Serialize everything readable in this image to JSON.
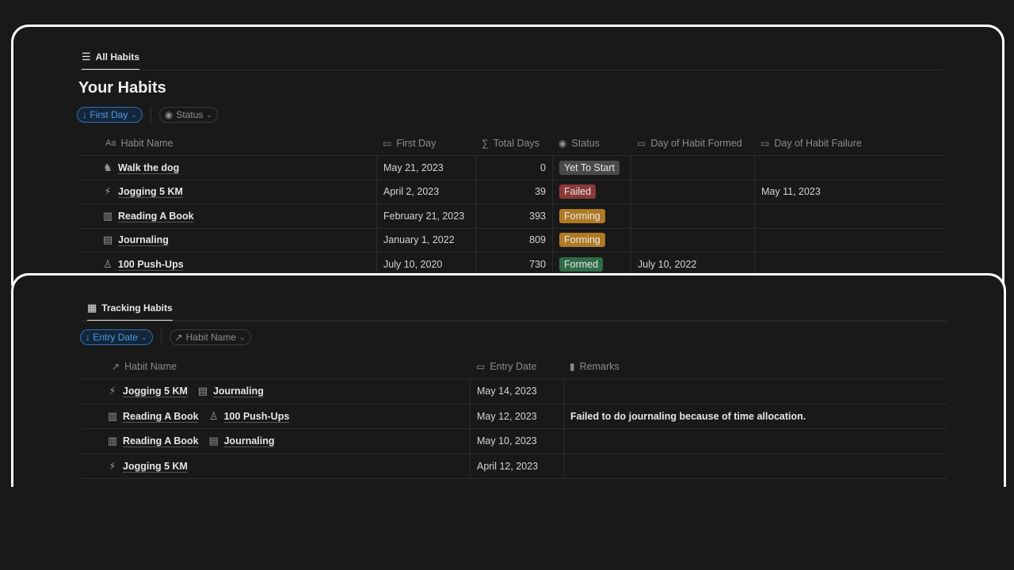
{
  "colors": {
    "background": "#191919",
    "frame": "#ffffff",
    "accent_blue": "#4d9be6",
    "status_yet_to_start": "#4a4a4a",
    "status_failed": "#8a3a37",
    "status_forming": "#b07a25",
    "status_formed": "#2f6b46"
  },
  "habits_view": {
    "tab_label": "All Habits",
    "tab_icon": "list-icon",
    "title": "Your Habits",
    "filters": [
      {
        "label": "↓ First Day",
        "icon": "chevron-down-icon",
        "active": true
      },
      {
        "label": "Status",
        "icon": "status-icon",
        "active": false
      }
    ],
    "columns": [
      {
        "label": "Habit Name",
        "icon": "Aa"
      },
      {
        "label": "First Day",
        "icon": "calendar-icon"
      },
      {
        "label": "Total Days",
        "icon": "formula-icon"
      },
      {
        "label": "Status",
        "icon": "status-icon"
      },
      {
        "label": "Day of Habit Formed",
        "icon": "calendar-icon"
      },
      {
        "label": "Day of Habit Failure",
        "icon": "calendar-icon"
      }
    ],
    "rows": [
      {
        "icon": "dog-icon",
        "name": "Walk the dog",
        "first_day": "May 21, 2023",
        "total_days": "0",
        "status": "Yet To Start",
        "status_color": "#4a4a4a",
        "formed": "",
        "failure": ""
      },
      {
        "icon": "runner-icon",
        "name": "Jogging 5 KM",
        "first_day": "April 2, 2023",
        "total_days": "39",
        "status": "Failed",
        "status_color": "#8a3a37",
        "formed": "",
        "failure": "May 11, 2023"
      },
      {
        "icon": "book-icon",
        "name": "Reading A Book",
        "first_day": "February 21, 2023",
        "total_days": "393",
        "status": "Forming",
        "status_color": "#b07a25",
        "formed": "",
        "failure": ""
      },
      {
        "icon": "notebook-icon",
        "name": "Journaling",
        "first_day": "January 1, 2022",
        "total_days": "809",
        "status": "Forming",
        "status_color": "#b07a25",
        "formed": "",
        "failure": ""
      },
      {
        "icon": "person-icon",
        "name": "100 Push-Ups",
        "first_day": "July 10, 2020",
        "total_days": "730",
        "status": "Formed",
        "status_color": "#2f6b46",
        "formed": "July 10, 2022",
        "failure": ""
      }
    ]
  },
  "tracking_view": {
    "tab_label": "Tracking Habits",
    "tab_icon": "table-icon",
    "filters": [
      {
        "label": "↓ Entry Date",
        "active": true
      },
      {
        "label": "Habit Name",
        "active": false
      }
    ],
    "columns": [
      {
        "label": "Habit Name",
        "icon": "relation-arrow-icon"
      },
      {
        "label": "Entry Date",
        "icon": "calendar-icon"
      },
      {
        "label": "Remarks",
        "icon": "document-icon"
      }
    ],
    "rows": [
      {
        "habits": [
          {
            "icon": "runner-icon",
            "name": "Jogging 5 KM"
          },
          {
            "icon": "notebook-icon",
            "name": "Journaling"
          }
        ],
        "entry_date": "May 14, 2023",
        "remarks": ""
      },
      {
        "habits": [
          {
            "icon": "book-icon",
            "name": "Reading A Book"
          },
          {
            "icon": "person-icon",
            "name": "100 Push-Ups"
          }
        ],
        "entry_date": "May 12, 2023",
        "remarks": "Failed to do journaling because of time allocation."
      },
      {
        "habits": [
          {
            "icon": "book-icon",
            "name": "Reading A Book"
          },
          {
            "icon": "notebook-icon",
            "name": "Journaling"
          }
        ],
        "entry_date": "May 10, 2023",
        "remarks": ""
      },
      {
        "habits": [
          {
            "icon": "runner-icon",
            "name": "Jogging 5 KM"
          }
        ],
        "entry_date": "April 12, 2023",
        "remarks": ""
      }
    ]
  }
}
